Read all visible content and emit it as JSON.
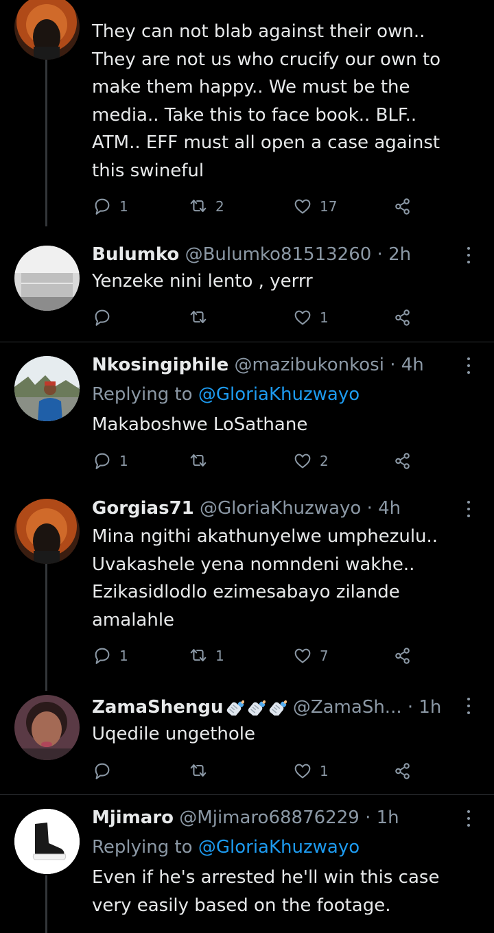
{
  "tweets": [
    {
      "name": "",
      "handle": "",
      "time": "",
      "replying_to": "",
      "text_lines": [
        "They can not blab against their own..",
        "They are not us who crucify our own to",
        "make them happy.. We must be the",
        "media.. Take this to face book.. BLF..",
        "ATM.. EFF must all open a case against",
        "this swineful"
      ],
      "replies": "1",
      "retweets": "2",
      "likes": "17"
    },
    {
      "name": "Bulumko",
      "handle": "@Bulumko81513260",
      "time": "· 2h",
      "replying_to": "",
      "text_lines": [
        "Yenzeke nini lento , yerrr"
      ],
      "replies": "",
      "retweets": "",
      "likes": "1"
    },
    {
      "name": "Nkosingiphile",
      "handle": "@mazibukonkosi",
      "time": "· 4h",
      "replying_to": "@GloriaKhuzwayo",
      "text_lines": [
        "Makaboshwe LoSathane"
      ],
      "replies": "1",
      "retweets": "",
      "likes": "2"
    },
    {
      "name": "Gorgias71",
      "handle": "@GloriaKhuzwayo",
      "time": "· 4h",
      "replying_to": "",
      "text_lines": [
        "Mina ngithi akathunyelwe umphezulu..",
        "Uvakashele yena nomndeni wakhe..",
        "Ezikasidlodlo ezimesabayo zilande",
        "amalahle"
      ],
      "replies": "1",
      "retweets": "1",
      "likes": "7"
    },
    {
      "name": "ZamaShengu",
      "handle": "@ZamaSh...",
      "time": "· 1h",
      "replying_to": "",
      "text_lines": [
        "Uqedile ungethole"
      ],
      "replies": "",
      "retweets": "",
      "likes": "1"
    },
    {
      "name": "Mjimaro",
      "handle": "@Mjimaro68876229",
      "time": "· 1h",
      "replying_to": "@GloriaKhuzwayo",
      "text_lines": [
        "Even if he's arrested he'll win this case",
        "very easily based on the footage."
      ],
      "replies": "",
      "retweets": "",
      "likes": ""
    }
  ],
  "labels": {
    "replying_to": "Replying to "
  },
  "icons": {
    "reply": "speech-bubble-icon",
    "retweet": "retweet-icon",
    "like": "heart-icon",
    "share": "share-icon",
    "more": "more-vertical-icon",
    "baby_bottle": "baby-bottle-emoji"
  },
  "colors": {
    "background": "#000000",
    "text": "#e7e9ea",
    "secondary": "#8b98a5",
    "link": "#1d9bf0",
    "divider": "#2f3336"
  }
}
